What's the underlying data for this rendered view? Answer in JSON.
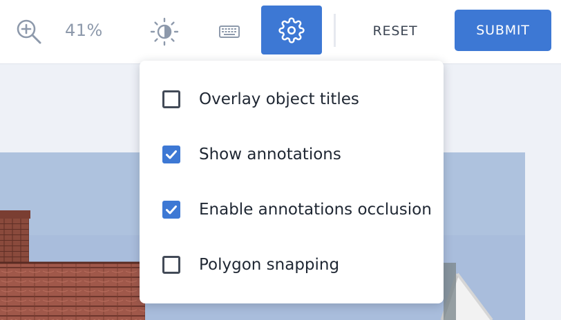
{
  "toolbar": {
    "zoom_icon": "zoom-in-icon",
    "zoom_level": "41%",
    "brightness_icon": "brightness-icon",
    "keyboard_icon": "keyboard-icon",
    "settings_icon": "gear-icon",
    "reset_label": "RESET",
    "submit_label": "SUBMIT"
  },
  "settings_menu": {
    "items": [
      {
        "label": "Overlay object titles",
        "checked": false
      },
      {
        "label": "Show annotations",
        "checked": true
      },
      {
        "label": "Enable annotations occlusion",
        "checked": true
      },
      {
        "label": "Polygon snapping",
        "checked": false
      }
    ]
  },
  "colors": {
    "accent": "#3d78d4",
    "icon_muted": "#8d99ab",
    "canvas_bg": "#eef1f7"
  }
}
